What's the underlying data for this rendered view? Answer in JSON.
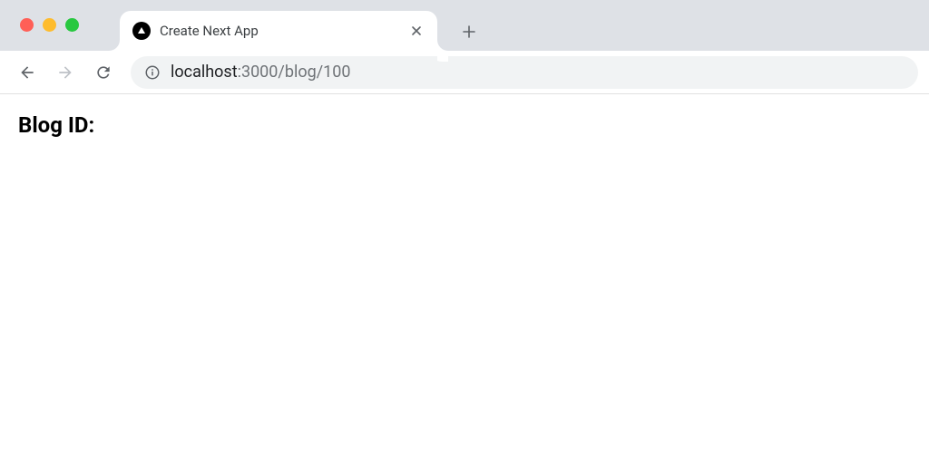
{
  "browser": {
    "tab": {
      "title": "Create Next App"
    },
    "url": {
      "host": "localhost",
      "port_and_path": ":3000/blog/100"
    }
  },
  "page": {
    "heading": "Blog ID:"
  }
}
